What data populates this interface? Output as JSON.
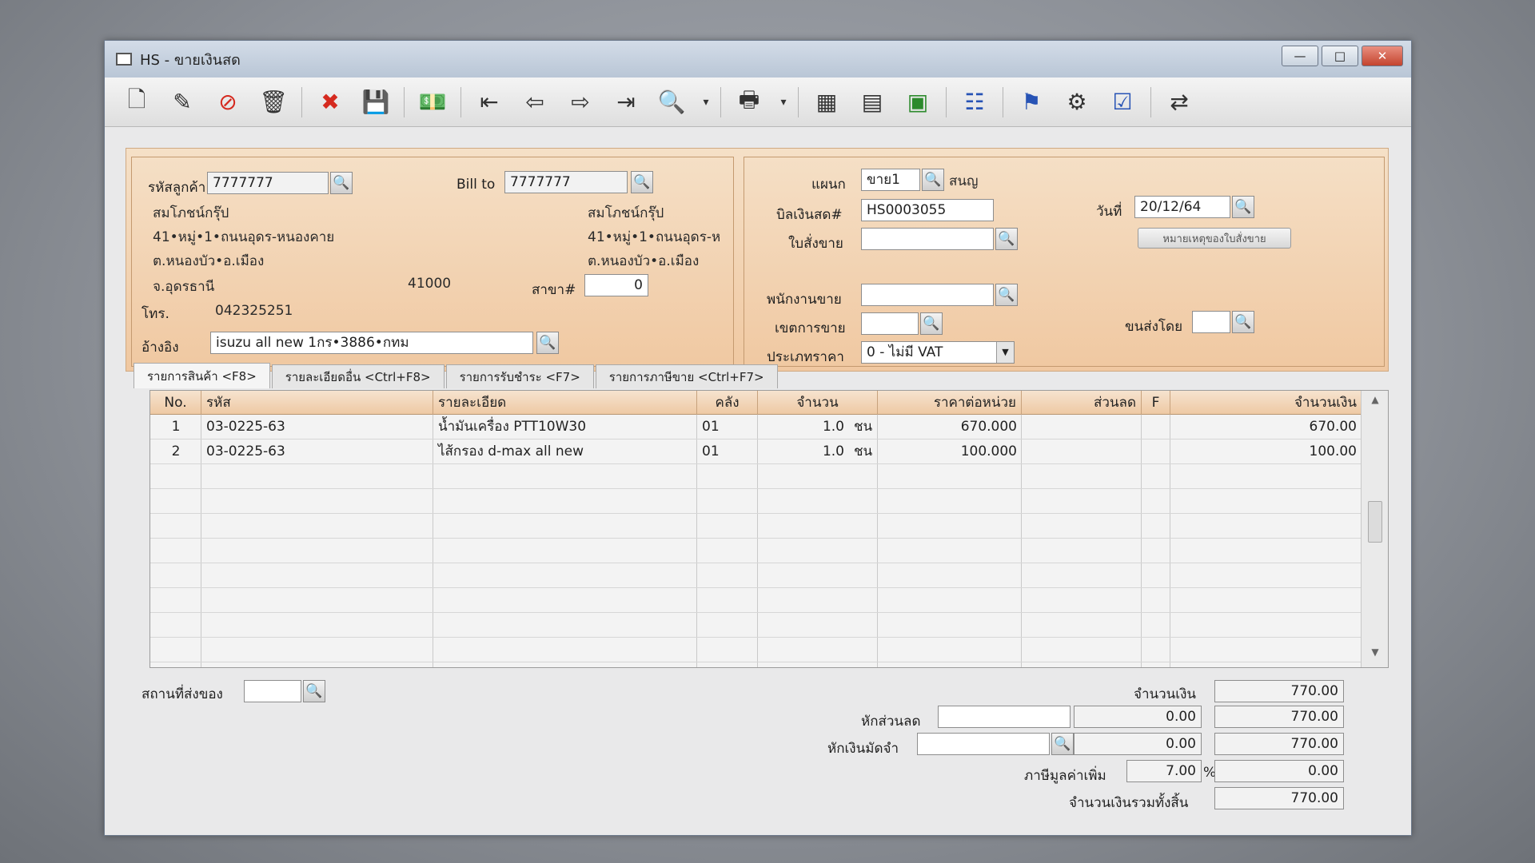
{
  "window": {
    "title": "HS - ขายเงินสด",
    "btn_minimize": "—",
    "btn_maximize": "□",
    "btn_close": "✕"
  },
  "toolbar": {
    "icons": [
      "new-document-icon",
      "edit-icon",
      "void-icon",
      "delete-icon",
      "cancel-icon",
      "save-icon",
      "money-icon",
      "first-record-icon",
      "previous-record-icon",
      "next-record-icon",
      "last-record-icon",
      "search-doc-icon",
      "print-icon",
      "calculator-icon",
      "register-icon",
      "cash-icon",
      "report-icon",
      "approve-icon",
      "tools-icon",
      "ok-icon",
      "transfer-icon"
    ]
  },
  "customer": {
    "code_label": "รหัสลูกค้า",
    "code_value": "7777777",
    "name": "สมโภชน์กรุ๊ป",
    "addr1": "41•หมู่•1•ถนนอุดร-หนองคาย",
    "addr2": "ต.หนองบัว•อ.เมือง",
    "addr3": "จ.อุดรธานี",
    "zip": "41000",
    "phone_label": "โทร.",
    "phone": "042325251",
    "ref_label": "อ้างอิง",
    "ref_value": "isuzu all new 1กร•3886•กทม"
  },
  "billto": {
    "label": "Bill to",
    "value": "7777777",
    "name": "สมโภชน์กรุ๊ป",
    "addr1": "41•หมู่•1•ถนนอุดร-ห",
    "addr2": "ต.หนองบัว•อ.เมือง",
    "branch_label": "สาขา#",
    "branch_value": "0"
  },
  "doc": {
    "dept_label": "แผนก",
    "dept_value": "ขาย1",
    "dept_name": "สนญ",
    "bill_label": "บิลเงินสด#",
    "bill_value": "HS0003055",
    "date_label": "วันที่",
    "date_value": "20/12/64",
    "order_label": "ใบสั่งขาย",
    "order_value": "",
    "order_note_btn": "หมายเหตุของใบสั่งขาย",
    "salesman_label": "พนักงานขาย",
    "salesman_value": "",
    "zone_label": "เขตการขาย",
    "zone_value": "",
    "ship_by_label": "ขนส่งโดย",
    "ship_by_value": "",
    "price_type_label": "ประเภทราคา",
    "price_type_value": "0 - ไม่มี VAT"
  },
  "tabs": [
    "รายการสินค้า <F8>",
    "รายละเอียดอื่น <Ctrl+F8>",
    "รายการรับชำระ <F7>",
    "รายการภาษีขาย <Ctrl+F7>"
  ],
  "grid": {
    "headers": {
      "no": "No.",
      "code": "รหัส",
      "desc": "รายละเอียด",
      "wh": "คลัง",
      "qty": "จำนวน",
      "price": "ราคาต่อหน่วย",
      "disc": "ส่วนลด",
      "f": "F",
      "amount": "จำนวนเงิน"
    },
    "rows": [
      {
        "no": "1",
        "code": "03-0225-63",
        "desc": "น้ำมันเครื่อง PTT10W30",
        "wh": "01",
        "qty": "1.0",
        "unit": "ชน",
        "price": "670.000",
        "disc": "",
        "f": "",
        "amount": "670.00"
      },
      {
        "no": "2",
        "code": "03-0225-63",
        "desc": "ไส้กรอง d-max all new",
        "wh": "01",
        "qty": "1.0",
        "unit": "ชน",
        "price": "100.000",
        "disc": "",
        "f": "",
        "amount": "100.00"
      }
    ]
  },
  "footer": {
    "ship_place_label": "สถานที่ส่งของ",
    "ship_place_value": "",
    "amount_label": "จำนวนเงิน",
    "amount_value": "770.00",
    "discount_label": "หักส่วนลด",
    "discount_text": "",
    "discount_value": "0.00",
    "after_discount": "770.00",
    "deposit_label": "หักเงินมัดจำ",
    "deposit_text": "",
    "deposit_value": "0.00",
    "after_deposit": "770.00",
    "vat_label": "ภาษีมูลค่าเพิ่ม",
    "vat_rate": "7.00",
    "vat_pct": "%",
    "vat_value": "0.00",
    "total_label": "จำนวนเงินรวมทั้งสิ้น",
    "total_value": "770.00"
  }
}
